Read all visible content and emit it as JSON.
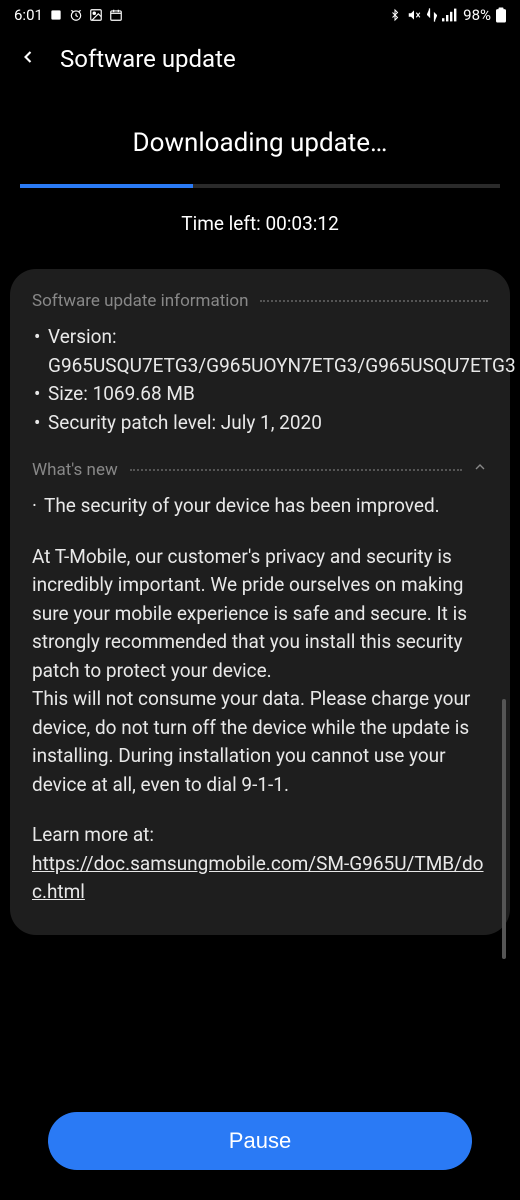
{
  "statusBar": {
    "time": "6:01",
    "batteryPercent": "98%"
  },
  "header": {
    "title": "Software update"
  },
  "download": {
    "title": "Downloading update…",
    "timeLeft": "Time left: 00:03:12"
  },
  "info": {
    "sectionTitle": "Software update information",
    "version": "Version: G965USQU7ETG3/G965UOYN7ETG3/G965USQU7ETG3",
    "size": "Size: 1069.68 MB",
    "security": "Security patch level: July 1, 2020"
  },
  "whatsNew": {
    "sectionTitle": "What's new",
    "item1": "The security of your device has been improved.",
    "para1": "At T-Mobile, our customer's privacy and security is incredibly important. We pride ourselves on making sure your mobile experience is safe and secure. It is strongly recommended that you install this security patch to protect your device.",
    "para2": " This will not consume your data.  Please charge your device,  do not turn off the device while the update is installing. During installation you cannot use your device at all, even to dial 9-1-1.",
    "learnMoreLabel": "Learn more at:",
    "learnMoreUrl": "https://doc.samsungmobile.com/SM-G965U/TMB/doc.html"
  },
  "actions": {
    "pause": "Pause"
  }
}
